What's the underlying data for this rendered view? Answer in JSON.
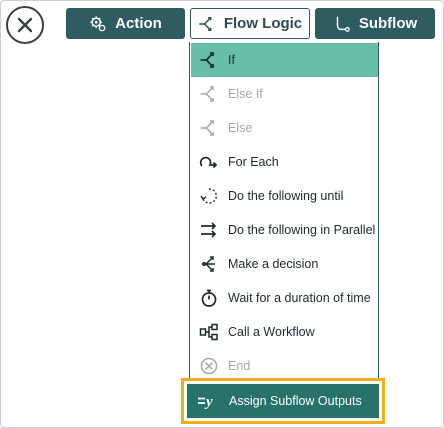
{
  "toolbar": {
    "action_label": "Action",
    "flow_logic_label": "Flow Logic",
    "subflow_label": "Subflow"
  },
  "menu": {
    "items": [
      {
        "label": "If",
        "icon": "branch-icon",
        "state": "selected"
      },
      {
        "label": "Else If",
        "icon": "branch-icon",
        "state": "disabled"
      },
      {
        "label": "Else",
        "icon": "branch-icon",
        "state": "disabled"
      },
      {
        "label": "For Each",
        "icon": "loop-arrow-icon",
        "state": "normal"
      },
      {
        "label": "Do the following until",
        "icon": "dashed-loop-icon",
        "state": "normal"
      },
      {
        "label": "Do the following in Parallel",
        "icon": "parallel-arrows-icon",
        "state": "normal"
      },
      {
        "label": "Make a decision",
        "icon": "decision-icon",
        "state": "normal"
      },
      {
        "label": "Wait for a duration of time",
        "icon": "stopwatch-icon",
        "state": "normal"
      },
      {
        "label": "Call a Workflow",
        "icon": "workflow-icon",
        "state": "normal"
      },
      {
        "label": "End",
        "icon": "end-icon",
        "state": "disabled"
      }
    ],
    "assign_label": "Assign Subflow Outputs",
    "assign_icon_text": "=y"
  },
  "colors": {
    "primary": "#2e5c60",
    "selected": "#67bfa6",
    "assign_bg": "#27736c",
    "highlight": "#f0ad14",
    "disabled": "#a3a9ac"
  }
}
